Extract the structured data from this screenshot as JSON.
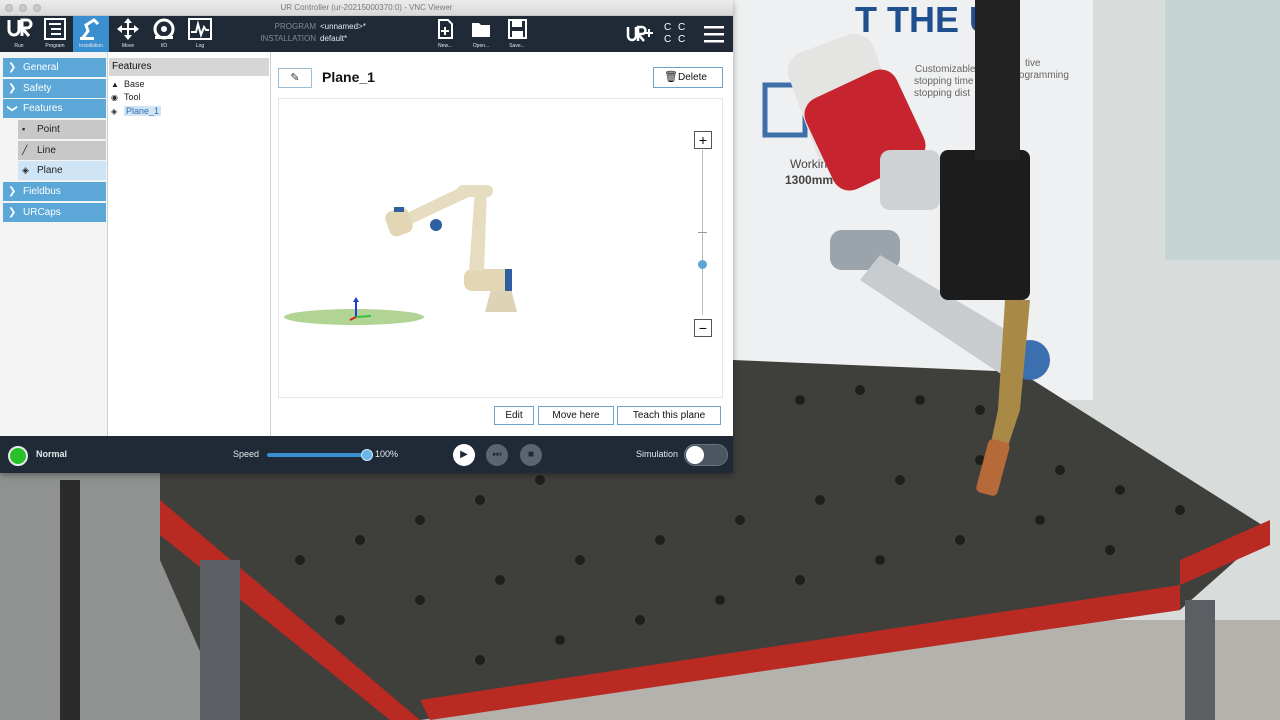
{
  "window": {
    "title": "UR Controller (ur-20215000370:0) - VNC Viewer"
  },
  "toolbar": {
    "buttons": [
      {
        "label": "Run",
        "icon": "ur-logo-icon"
      },
      {
        "label": "Program",
        "icon": "program-icon"
      },
      {
        "label": "Installation",
        "icon": "installation-icon",
        "active": true
      },
      {
        "label": "Move",
        "icon": "move-icon"
      },
      {
        "label": "I/O",
        "icon": "io-icon"
      },
      {
        "label": "Log",
        "icon": "log-icon"
      }
    ],
    "program_key": "PROGRAM",
    "program_value": "<unnamed>*",
    "installation_key": "INSTALLATION",
    "installation_value": "default*",
    "file_buttons": [
      {
        "label": "New...",
        "icon": "new-file-icon"
      },
      {
        "label": "Open...",
        "icon": "open-folder-icon"
      },
      {
        "label": "Save...",
        "icon": "save-icon"
      }
    ],
    "ur_plus_icon": "ur-plus-icon",
    "cc_text": "C C\nC C",
    "menu_icon": "hamburger-menu-icon"
  },
  "nav": {
    "items": [
      {
        "label": "General",
        "expanded": false
      },
      {
        "label": "Safety",
        "expanded": false
      },
      {
        "label": "Features",
        "expanded": true
      },
      {
        "label": "Fieldbus",
        "expanded": false
      },
      {
        "label": "URCaps",
        "expanded": false
      }
    ],
    "sub_items": [
      {
        "label": "Point",
        "icon": "point-icon"
      },
      {
        "label": "Line",
        "icon": "line-icon"
      },
      {
        "label": "Plane",
        "icon": "plane-icon",
        "selected": true
      }
    ]
  },
  "tree": {
    "header": "Features",
    "items": [
      {
        "label": "Base",
        "icon": "base-icon"
      },
      {
        "label": "Tool",
        "icon": "tool-icon"
      },
      {
        "label": "Plane_1",
        "icon": "plane-icon",
        "selected": true
      }
    ]
  },
  "main": {
    "feature_name": "Plane_1",
    "delete_label": "Delete",
    "zoom_in": "+",
    "zoom_out": "−",
    "edit_label": "Edit",
    "move_here_label": "Move here",
    "teach_label": "Teach this plane"
  },
  "footer": {
    "status": "Normal",
    "speed_label": "Speed",
    "speed_value": "100%",
    "speed_fraction": 1.0,
    "simulation_label": "Simulation",
    "simulation_on": false
  },
  "colors": {
    "toolbar_bg": "#1f2a36",
    "accent": "#3a8fd0",
    "nav_item": "#5aa7d8",
    "status_ok": "#28c12a"
  },
  "background": {
    "poster_text": "T THE UR",
    "poster_lines": [
      "Customizable",
      "stopping time",
      "stopping dist",
      "Working",
      "1300mm /",
      "programming",
      "tive"
    ]
  }
}
